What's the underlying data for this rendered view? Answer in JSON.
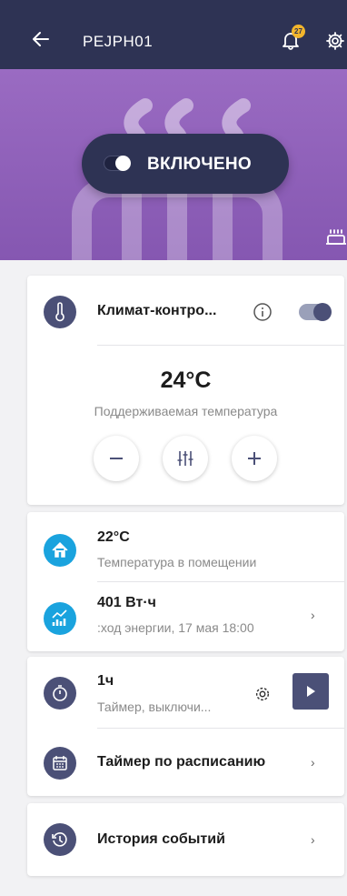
{
  "header": {
    "title": "PEJPH01",
    "notification_count": "27"
  },
  "hero": {
    "power_label": "ВКЛЮЧЕНО"
  },
  "climate": {
    "title": "Климат-контро...",
    "temperature": "24°C",
    "temperature_caption": "Поддерживаемая температура",
    "toggle_on": true
  },
  "room": {
    "value": "22°C",
    "caption": "Температура в помещении"
  },
  "energy": {
    "value": "401 Вт·ч",
    "caption": ":ход энергии, 17 мая 18:00"
  },
  "timer": {
    "value": "1ч",
    "caption": "Таймер, выключи..."
  },
  "schedule": {
    "label": "Таймер по расписанию"
  },
  "history": {
    "label": "История событий"
  },
  "colors": {
    "header": "#2e3354",
    "accent_dark": "#4b5077",
    "accent_blue": "#1aa3de",
    "hero": "#8d5db7",
    "badge": "#f2b52c"
  },
  "icons": [
    "back-arrow-icon",
    "bell-icon",
    "gear-icon",
    "heater-icon",
    "thermometer-icon",
    "info-icon",
    "minus-icon",
    "sliders-icon",
    "plus-icon",
    "home-icon",
    "energy-chart-icon",
    "stopwatch-icon",
    "play-icon",
    "calendar-icon",
    "history-icon",
    "chevron-right-icon"
  ]
}
